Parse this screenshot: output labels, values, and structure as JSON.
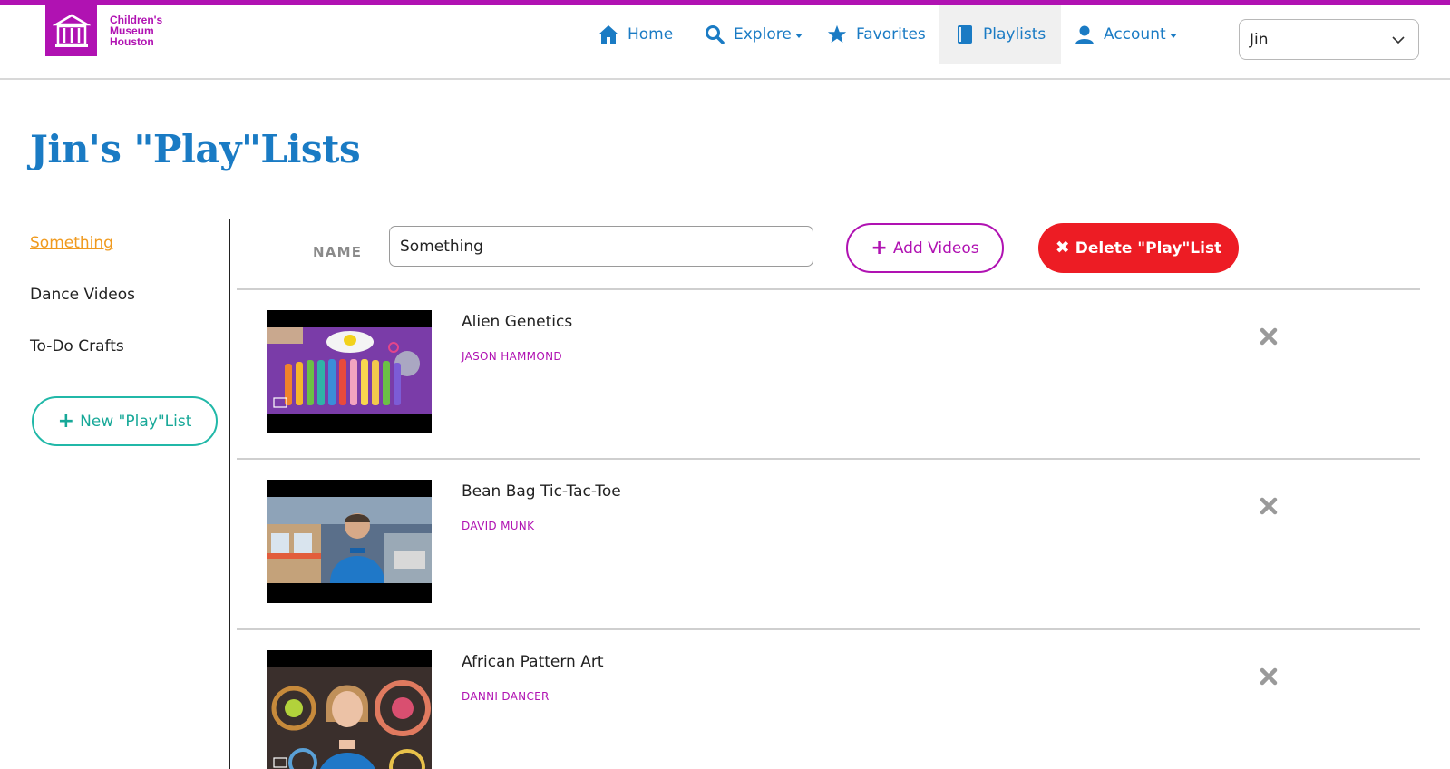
{
  "brand": {
    "name_lines": [
      "Children's",
      "Museum",
      "Houston"
    ],
    "logo_color": "#b012b2"
  },
  "nav": {
    "items": [
      {
        "label": "Home",
        "icon": "home-icon"
      },
      {
        "label": "Explore",
        "icon": "search-icon",
        "dropdown": true
      },
      {
        "label": "Favorites",
        "icon": "star-icon"
      },
      {
        "label": "Playlists",
        "icon": "book-icon",
        "active": true
      },
      {
        "label": "Account",
        "icon": "user-icon",
        "dropdown": true
      }
    ],
    "user_select": {
      "value": "Jin"
    }
  },
  "page": {
    "title": "Jin's \"Play\"Lists"
  },
  "sidebar": {
    "playlists": [
      {
        "label": "Something",
        "active": true
      },
      {
        "label": "Dance Videos"
      },
      {
        "label": "To-Do Crafts"
      }
    ],
    "new_button_label": "New \"Play\"List"
  },
  "editor": {
    "name_label": "NAME",
    "name_value": "Something",
    "add_button_label": "Add Videos",
    "delete_button_label": "Delete \"Play\"List"
  },
  "videos": [
    {
      "title": "Alien Genetics",
      "author": "JASON HAMMOND"
    },
    {
      "title": "Bean Bag Tic-Tac-Toe",
      "author": "DAVID MUNK"
    },
    {
      "title": "African Pattern Art",
      "author": "DANNI DANCER"
    }
  ],
  "colors": {
    "accent_blue": "#1a7bc4",
    "brand_magenta": "#b012b2",
    "active_orange": "#f09a1e",
    "teal": "#21b8a8",
    "danger_red": "#ed1c24"
  }
}
